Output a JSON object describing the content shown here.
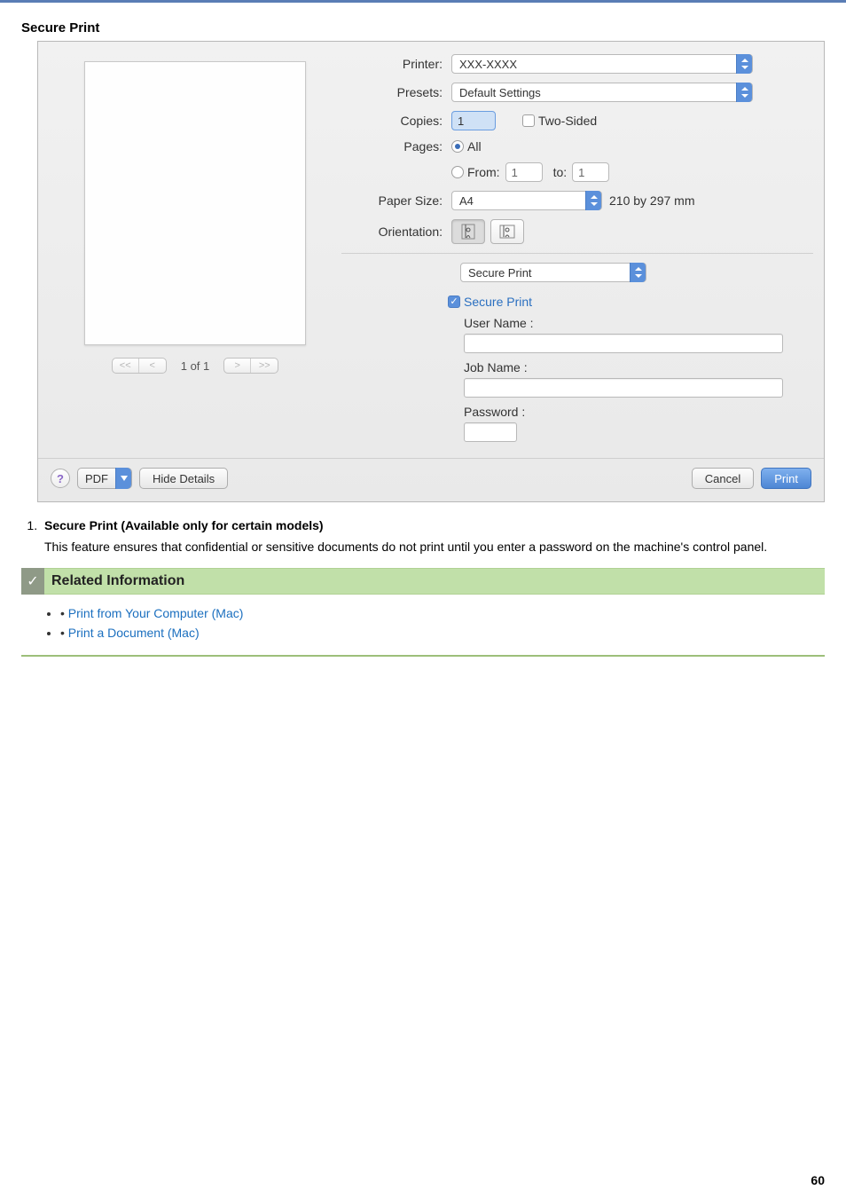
{
  "page_number": "60",
  "section_title": "Secure Print",
  "dialog": {
    "labels": {
      "printer": "Printer:",
      "presets": "Presets:",
      "copies": "Copies:",
      "two_sided": "Two-Sided",
      "pages": "Pages:",
      "pages_all": "All",
      "pages_from": "From:",
      "pages_to": "to:",
      "paper_size": "Paper Size:",
      "paper_dim": "210 by 297 mm",
      "orientation": "Orientation:",
      "pane_select": "Secure Print",
      "secure_print_chk": "Secure Print",
      "user_name": "User Name :",
      "job_name": "Job Name :",
      "password": "Password :"
    },
    "values": {
      "printer": "XXX-XXXX",
      "presets": "Default Settings",
      "copies": "1",
      "pages_from": "1",
      "pages_to": "1",
      "paper_size": "A4"
    },
    "nav": {
      "first": "<<",
      "prev": "<",
      "count": "1 of 1",
      "next": ">",
      "last": ">>"
    },
    "footer": {
      "help": "?",
      "pdf": "PDF",
      "hide_details": "Hide Details",
      "cancel": "Cancel",
      "print": "Print"
    }
  },
  "content": {
    "item_title": "Secure Print (Available only for certain models)",
    "item_body": "This feature ensures that confidential or sensitive documents do not print until you enter a password on the machine's control panel."
  },
  "related": {
    "heading": "Related Information",
    "links": [
      "Print from Your Computer (Mac)",
      "Print a Document (Mac)"
    ]
  }
}
